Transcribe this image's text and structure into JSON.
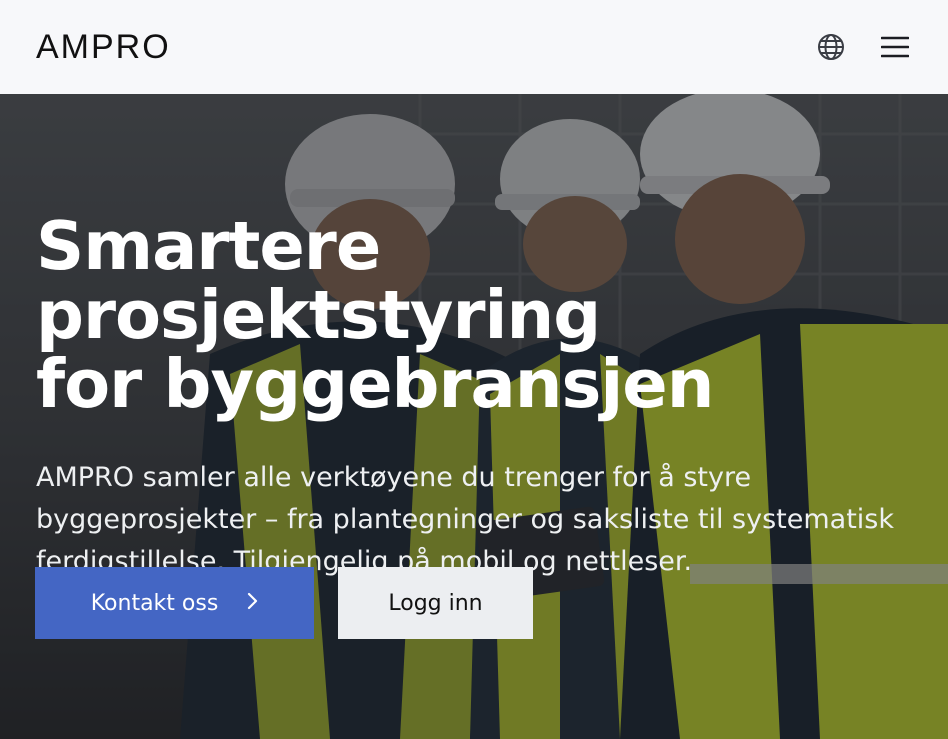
{
  "brand": {
    "logo_text": "AMPRO"
  },
  "header": {
    "language_icon": "globe-icon",
    "menu_icon": "hamburger-menu-icon"
  },
  "hero": {
    "title_line1": "Smartere prosjektstyring",
    "title_line2": "for byggebransjen",
    "description": "AMPRO samler alle verktøyene du trenger for å styre byggeprosjekter – fra plantegninger og saksliste til systematisk ferdigstillelse. Tilgjengelig på mobil og nettleser.",
    "primary_cta": "Kontakt oss",
    "primary_cta_icon": "chevron-right-icon",
    "secondary_cta": "Logg inn",
    "background_image": "construction-workers-hardhats-photo"
  },
  "colors": {
    "header_bg": "#f7f8fa",
    "primary_button": "#4466c4",
    "secondary_button": "#eceef1",
    "vest_yellow": "#c9dc2e"
  }
}
